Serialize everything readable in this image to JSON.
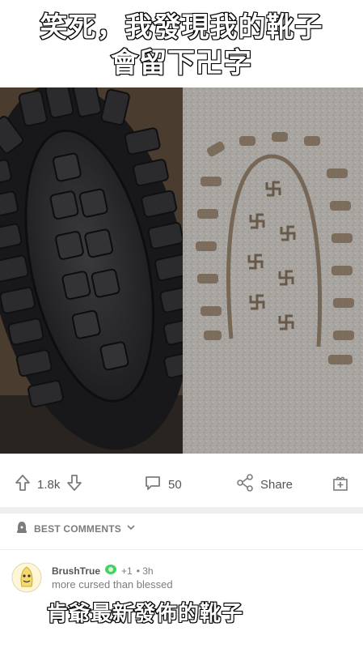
{
  "captions": {
    "line1": "笑死，我發現我的靴子",
    "line2": "會留下卍字",
    "line3": "肯爺最新發佈的靴子"
  },
  "photos": {
    "left_name": "boot-sole-photo",
    "right_name": "footprint-photo"
  },
  "actions": {
    "upvotes": "1.8k",
    "comments": "50",
    "share": "Share"
  },
  "best_comments": {
    "label": "BEST COMMENTS"
  },
  "comment": {
    "username": "BrushTrue",
    "flair": "+1",
    "time": "• 3h",
    "body": "more cursed than blessed"
  },
  "colors": {
    "caption_fill": "#ffffff",
    "caption_stroke": "#000000",
    "meta_gray": "#7c7c7c",
    "divider": "#edeff1"
  },
  "icons": [
    "upvote-icon",
    "downvote-icon",
    "comment-icon",
    "share-icon",
    "award-icon",
    "lock-icon",
    "chevron-down-icon",
    "avatar-icon"
  ]
}
